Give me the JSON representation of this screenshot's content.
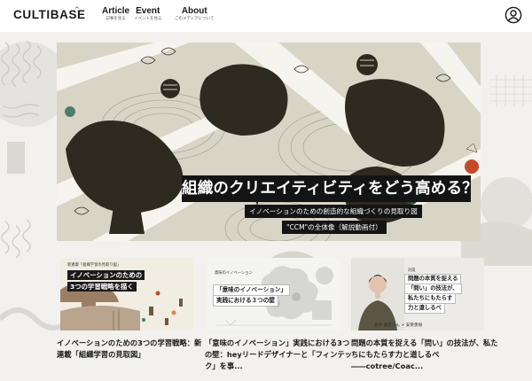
{
  "header": {
    "logo": "CULTIBASE",
    "nav": [
      {
        "label": "Article",
        "sub": "記事を見る"
      },
      {
        "label": "Event",
        "sub": "イベントを見る"
      },
      {
        "label": "About",
        "sub": "このメディアについて"
      }
    ],
    "user_icon": "user-circle-icon"
  },
  "hero": {
    "title": "組織のクリエイティビティをどう高める？",
    "subtitle_1": "イノベーションのための創造的な組織づくりの見取り図",
    "subtitle_2": "\"CCM\"の全体像（解説動画付）"
  },
  "cards": [
    {
      "tag": "新連載「組織学習の見取り図」",
      "heading_1": "イノベーションのための",
      "heading_2": "3つの学習戦略を描く",
      "title": "イノベーションのための3つの学習戦略：新連載「組織学習の見取図」"
    },
    {
      "tag": "意味のイノベーション",
      "heading_1": "「意味のイノベーション」",
      "heading_2": "実践における３つの壁",
      "title": "「意味のイノベーション」実践における3つの壁：heyリードデザイナーと「フィンテック」を事..."
    },
    {
      "tag": "対談",
      "heading_1": "問題の本質を捉える",
      "heading_2": "「問い」の技法が、",
      "heading_3": "私たちにもたらす",
      "heading_4": "力と遠しるべ",
      "names": "春木 園歌さん × 安斎勇樹",
      "title": "問題の本質を捉える「問い」の技法が、私たちにもたらす力と道しるべ――cotree/Coac..."
    }
  ],
  "colors": {
    "accent": "#1a1a1a",
    "hero_bg": "#d9d5c6",
    "page_bg": "#f2f1ee"
  }
}
